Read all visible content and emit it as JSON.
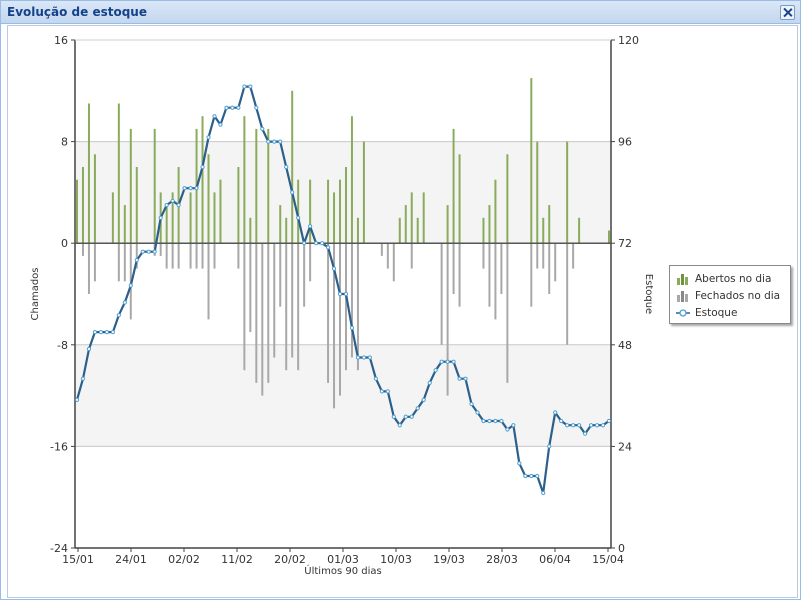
{
  "window": {
    "title": "Evolução de estoque",
    "close_icon": "close-icon"
  },
  "chart_data": {
    "type": "bar+line",
    "xlabel": "Últimos 90 dias",
    "ylabel_left": "Chamados",
    "ylabel_right": "Estoque",
    "ylim_left": [
      -24,
      16
    ],
    "ylim_right": [
      0,
      120
    ],
    "yticks_left": [
      "16",
      "8",
      "0",
      "-8",
      "-16",
      "-24"
    ],
    "yticks_right": [
      "120",
      "96",
      "72",
      "48",
      "24",
      "0"
    ],
    "x_tick_labels": [
      "15/01",
      "24/01",
      "02/02",
      "11/02",
      "20/02",
      "01/03",
      "10/03",
      "19/03",
      "28/03",
      "06/04",
      "15/04"
    ],
    "grid": true,
    "legend": "right",
    "colors": {
      "abertos": "#8aab5c",
      "fechados": "#a8a8a8",
      "estoque_line": "#2c5f8a",
      "estoque_point": "#4f9fcf",
      "band": "#f4f4f4"
    },
    "series": [
      {
        "name": "Abertos no dia",
        "type": "bar",
        "axis": "left",
        "values": [
          5,
          6,
          11,
          7,
          0,
          0,
          4,
          11,
          3,
          9,
          6,
          0,
          0,
          9,
          4,
          3,
          4,
          6,
          0,
          4,
          9,
          10,
          7,
          4,
          5,
          0,
          0,
          6,
          10,
          2,
          9,
          0,
          9,
          0,
          3,
          2,
          12,
          5,
          0,
          5,
          0,
          0,
          5,
          4,
          5,
          6,
          10,
          2,
          8,
          0,
          0,
          0,
          0,
          0,
          2,
          3,
          4,
          2,
          4,
          0,
          0,
          0,
          3,
          9,
          7,
          0,
          0,
          0,
          2,
          3,
          5,
          0,
          7,
          0,
          0,
          0,
          13,
          8,
          2,
          3,
          0,
          0,
          8,
          0,
          2,
          0,
          0,
          0,
          0,
          1
        ]
      },
      {
        "name": "Fechados no dia",
        "type": "bar",
        "axis": "left",
        "values": [
          0,
          -1,
          -4,
          -3,
          0,
          0,
          0,
          -3,
          -3,
          -6,
          -2,
          0,
          0,
          -1,
          -1,
          -2,
          -2,
          -2,
          0,
          -2,
          -2,
          -2,
          -6,
          -2,
          0,
          0,
          0,
          -2,
          -10,
          -7,
          -11,
          -12,
          -11,
          -9,
          -5,
          -10,
          -9,
          -10,
          -5,
          -3,
          0,
          0,
          -11,
          -13,
          -12,
          -10,
          -9,
          -10,
          0,
          0,
          0,
          -1,
          -2,
          -3,
          0,
          0,
          -2,
          0,
          0,
          0,
          0,
          -8,
          -12,
          -4,
          -5,
          0,
          0,
          0,
          -2,
          -5,
          -6,
          -4,
          -11,
          0,
          0,
          0,
          -5,
          -2,
          -2,
          -4,
          -3,
          0,
          -8,
          -2,
          0,
          0,
          0,
          0,
          0,
          0
        ]
      },
      {
        "name": "Estoque",
        "type": "line",
        "axis": "right",
        "values": [
          35,
          40,
          47,
          51,
          51,
          51,
          51,
          55,
          58,
          62,
          68,
          70,
          70,
          70,
          78,
          81,
          82,
          81,
          85,
          85,
          85,
          90,
          97,
          102,
          100,
          104,
          104,
          104,
          109,
          109,
          104,
          99,
          96,
          96,
          96,
          90,
          84,
          78,
          72,
          76,
          72,
          72,
          71,
          66,
          60,
          60,
          52,
          45,
          45,
          45,
          40,
          37,
          37,
          31,
          29,
          31,
          31,
          33,
          35,
          39,
          42,
          44,
          44,
          44,
          40,
          40,
          34,
          32,
          30,
          30,
          30,
          30,
          28,
          29,
          20,
          17,
          17,
          17,
          13,
          24,
          32,
          30,
          29,
          29,
          29,
          27,
          29,
          29,
          29,
          30
        ]
      }
    ]
  },
  "legend": {
    "items": [
      {
        "label": "Abertos no dia",
        "icon": "green-bar-chart-icon"
      },
      {
        "label": "Fechados no dia",
        "icon": "gray-bar-chart-icon"
      },
      {
        "label": "Estoque",
        "icon": "line-point-icon"
      }
    ]
  }
}
